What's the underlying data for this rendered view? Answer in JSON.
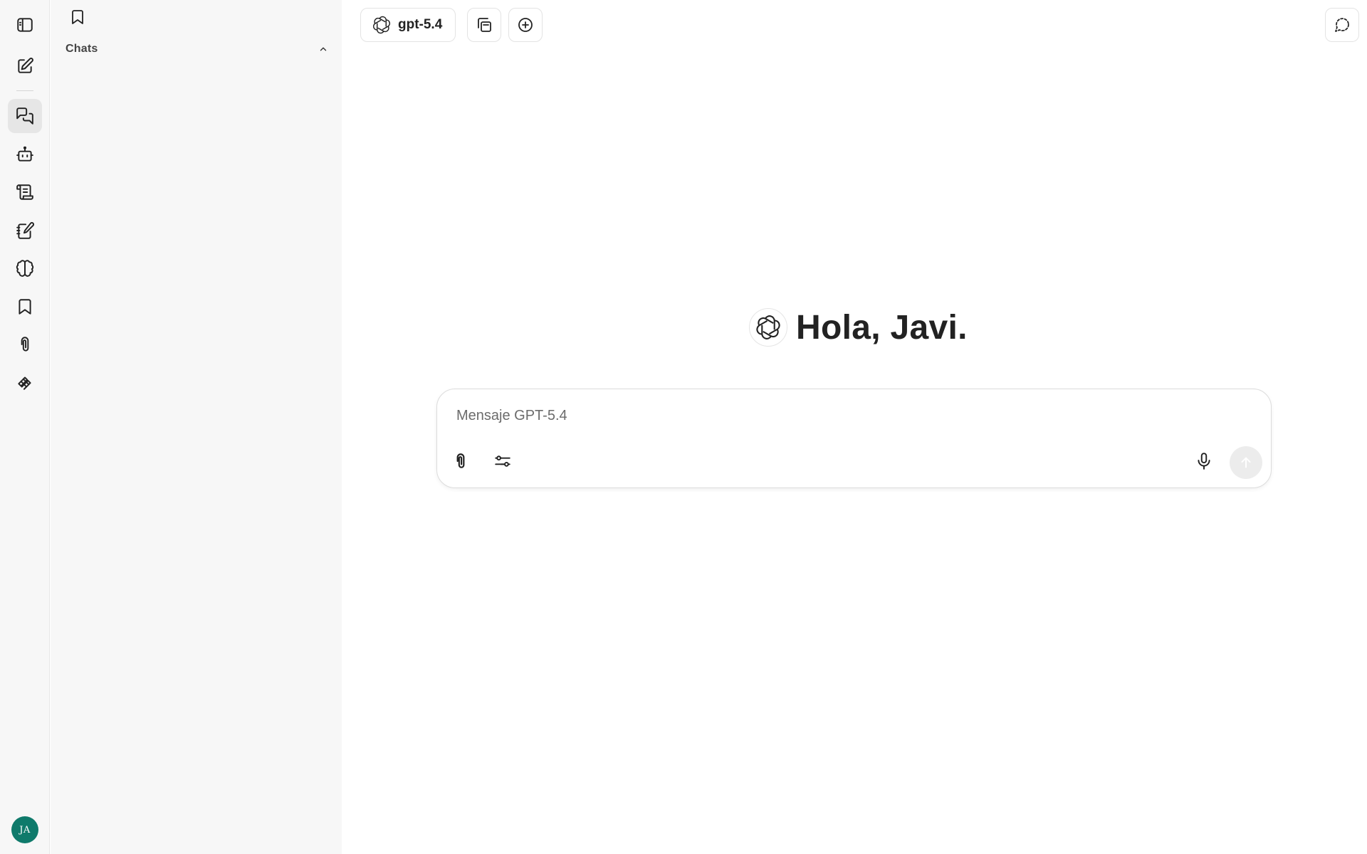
{
  "rail": {
    "items": [
      {
        "icon": "sidebar-toggle-icon",
        "active": false
      },
      {
        "icon": "new-chat-icon",
        "active": false
      },
      {
        "icon": "chats-icon",
        "active": true
      },
      {
        "icon": "agents-icon",
        "active": false
      },
      {
        "icon": "prompts-icon",
        "active": false
      },
      {
        "icon": "notes-icon",
        "active": false
      },
      {
        "icon": "memories-icon",
        "active": false
      },
      {
        "icon": "bookmarks-icon",
        "active": false
      },
      {
        "icon": "attachments-icon",
        "active": false
      },
      {
        "icon": "tools-icon",
        "active": false
      }
    ],
    "avatar_initials": "JA",
    "avatar_color": "#0f7a6b"
  },
  "panel": {
    "section_title": "Chats"
  },
  "topbar": {
    "model_label": "gpt-5.4"
  },
  "greeting": {
    "text": "Hola, Javi."
  },
  "composer": {
    "placeholder": "Mensaje GPT-5.4",
    "value": ""
  }
}
